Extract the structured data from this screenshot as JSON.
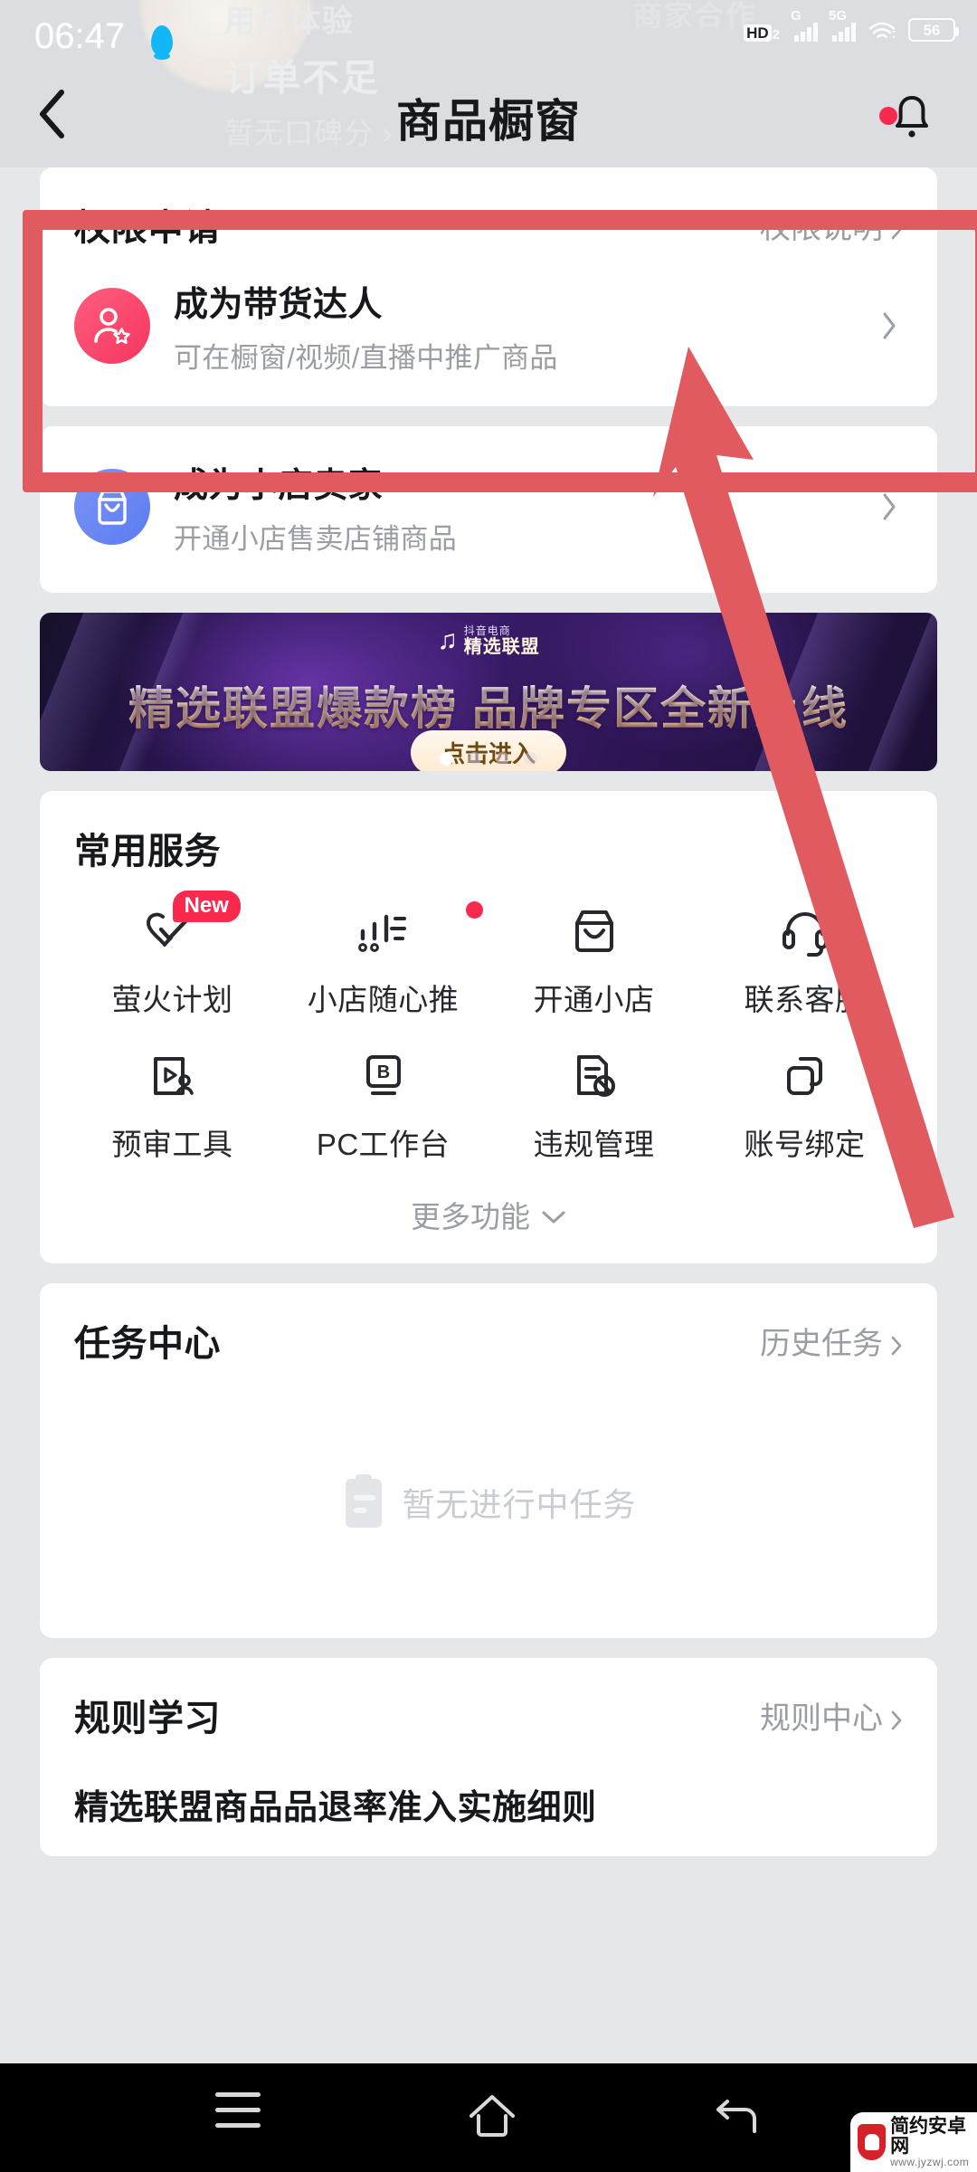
{
  "status_bar": {
    "time": "06:47",
    "hd_label": "HD",
    "hd_sub": "2",
    "signal1_label": "G",
    "signal2_label": "5G",
    "battery_level": "56"
  },
  "background_ghost": {
    "line_user_experience": "用户体验",
    "line_merchant_coop": "商家合作",
    "line_orders": "订单不足",
    "line_score": "暂无口碑分 ›"
  },
  "header": {
    "title": "商品橱窗",
    "back_icon": "chevron-left-icon",
    "bell_icon": "bell-icon",
    "has_notification_dot": true
  },
  "permission_card": {
    "title": "权限申请",
    "link_label": "权限说明",
    "rows": [
      {
        "title": "成为带货达人",
        "subtitle": "可在橱窗/视频/直播中推广商品",
        "icon": "user-star-icon",
        "icon_color": "#f5355f"
      },
      {
        "title": "成为小店卖家",
        "subtitle": "开通小店售卖店铺商品",
        "icon": "shop-icon",
        "icon_color": "#5a7cf0"
      }
    ]
  },
  "banner": {
    "logo_top": "抖音电商",
    "logo_bottom": "精选联盟",
    "title": "精选联盟爆款榜 品牌专区全新上线",
    "cta_label": "点击进入",
    "dots_total": 4,
    "dots_active_index": 0
  },
  "services": {
    "title": "常用服务",
    "items": [
      {
        "label": "萤火计划",
        "icon": "double-check-heart-icon",
        "badge": "New"
      },
      {
        "label": "小店随心推",
        "icon": "promote-bars-icon",
        "dot": true
      },
      {
        "label": "开通小店",
        "icon": "shop-outline-icon"
      },
      {
        "label": "联系客服",
        "icon": "headset-icon"
      },
      {
        "label": "预审工具",
        "icon": "play-review-icon"
      },
      {
        "label": "PC工作台",
        "icon": "b-workbench-icon"
      },
      {
        "label": "违规管理",
        "icon": "doc-ban-icon"
      },
      {
        "label": "账号绑定",
        "icon": "link-copy-icon"
      }
    ],
    "more_label": "更多功能",
    "more_icon": "chevron-down-icon"
  },
  "task_center": {
    "title": "任务中心",
    "link_label": "历史任务",
    "empty_text": "暂无进行中任务",
    "empty_icon": "clipboard-icon"
  },
  "rules": {
    "title": "规则学习",
    "link_label": "规则中心",
    "items": [
      "精选联盟商品品退率准入实施细则"
    ]
  },
  "annotation": {
    "color": "#e05a5f",
    "shape": "rectangle-and-arrow",
    "target": "成为带货达人"
  },
  "nav_bar": {
    "menu_icon": "menu-icon",
    "home_icon": "home-icon",
    "back_icon": "back-arrow-icon"
  },
  "watermark": {
    "site_name": "简约安卓网",
    "site_url": "www.jyzwj.com"
  }
}
